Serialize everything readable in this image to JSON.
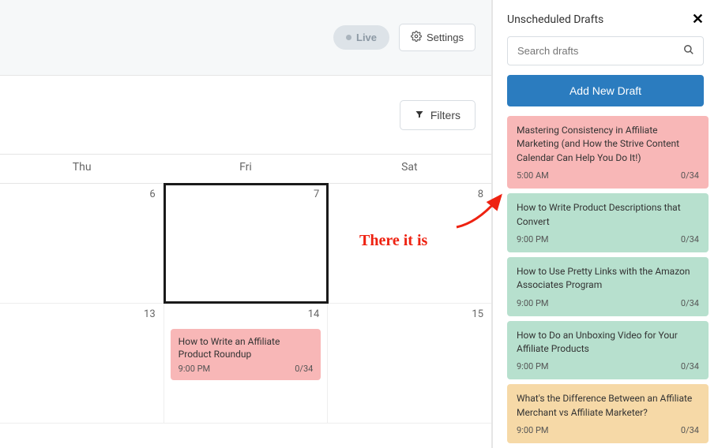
{
  "topbar": {
    "live_label": "Live",
    "settings_label": "Settings"
  },
  "filterbar": {
    "filters_label": "Filters"
  },
  "calendar": {
    "days": [
      "Thu",
      "Fri",
      "Sat"
    ],
    "rows": [
      {
        "cells": [
          {
            "num": "6"
          },
          {
            "num": "7",
            "highlight": true
          },
          {
            "num": "8"
          }
        ]
      },
      {
        "cells": [
          {
            "num": "13"
          },
          {
            "num": "14",
            "event": {
              "title": "How to Write an Affiliate Product Roundup",
              "time": "9:00 PM",
              "ratio": "0/34",
              "color": "pink"
            }
          },
          {
            "num": "15"
          }
        ]
      }
    ]
  },
  "sidebar": {
    "title": "Unscheduled Drafts",
    "close": "✕",
    "search_placeholder": "Search drafts",
    "add_label": "Add New Draft",
    "drafts": [
      {
        "title": "Mastering Consistency in Affiliate Marketing (and How the Strive Content Calendar Can Help You Do It!)",
        "time": "5:00 AM",
        "ratio": "0/34",
        "color": "pink"
      },
      {
        "title": "How to Write Product Descriptions that Convert",
        "time": "9:00 PM",
        "ratio": "0/34",
        "color": "green"
      },
      {
        "title": "How to Use Pretty Links with the Amazon Associates Program",
        "time": "9:00 PM",
        "ratio": "0/34",
        "color": "green"
      },
      {
        "title": "How to Do an Unboxing Video for Your Affiliate Products",
        "time": "9:00 PM",
        "ratio": "0/34",
        "color": "green"
      },
      {
        "title": "What's the Difference Between an Affiliate Merchant vs Affiliate Marketer?",
        "time": "9:00 PM",
        "ratio": "0/34",
        "color": "orange"
      }
    ]
  },
  "annotation": {
    "text": "There it is"
  }
}
